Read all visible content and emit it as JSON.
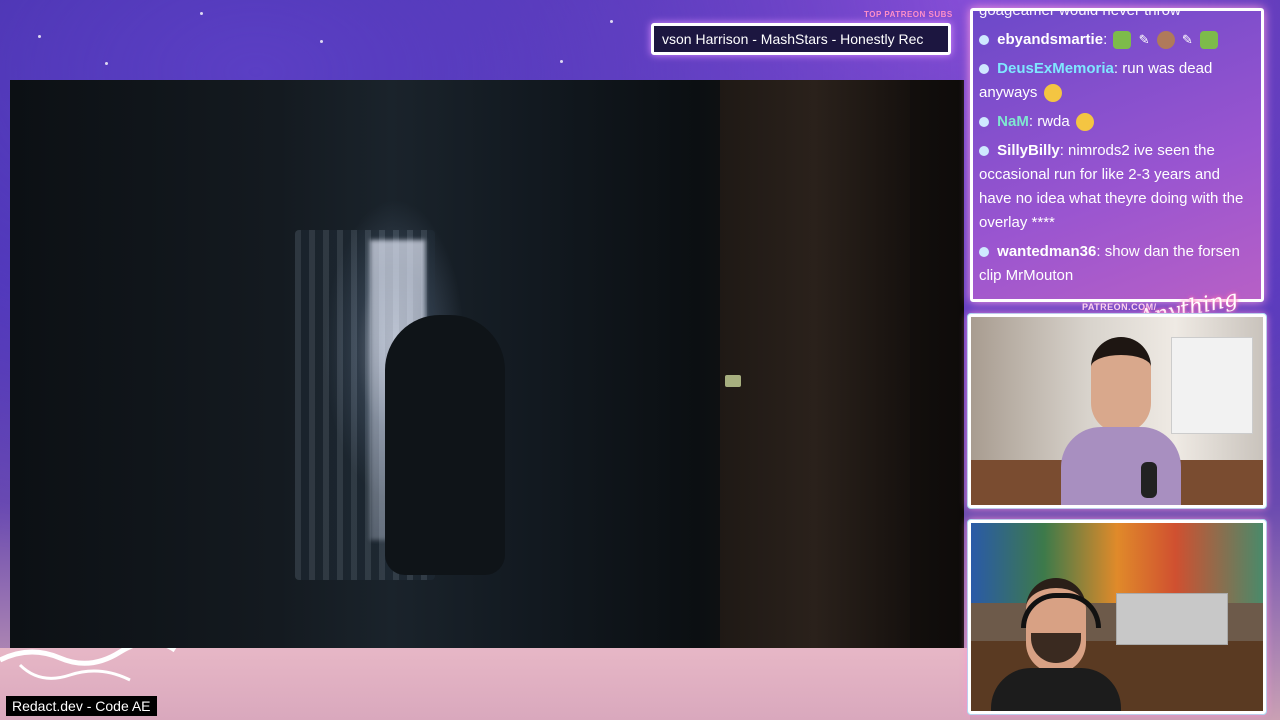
{
  "ticker": {
    "label": "TOP PATREON SUBS",
    "text": "vson Harrison - MashStars - Honestly Rec"
  },
  "chat": {
    "partial_top": "goageamer would never throw",
    "messages": [
      {
        "user": "ebyandsmartie",
        "text": "",
        "name_color": "#ffffff"
      },
      {
        "user": "DeusExMemoria",
        "text": "run was dead anyways",
        "name_color": "#7fe7ff"
      },
      {
        "user": "NaM",
        "text": "rwda",
        "name_color": "#7fe7d0"
      },
      {
        "user": "SillyBilly",
        "text": "nimrods2 ive seen the occasional run for like 2-3 years and have no idea what theyre doing with the overlay ****",
        "name_color": "#ffffff"
      },
      {
        "user": "wantedman36",
        "text": "show dan the forsen clip MrMouton",
        "name_color": "#ffffff"
      }
    ]
  },
  "patreon": {
    "label": "PATREON.COM/",
    "logo": "Anything Else?"
  },
  "bottom_label": "Redact.dev - Code AE",
  "colors": {
    "frame_glow": "#ff9de2",
    "ticker_label": "#ff8fc8"
  },
  "icons": [
    "chat-bullet-icon",
    "emote-icon",
    "pencil-icon"
  ]
}
